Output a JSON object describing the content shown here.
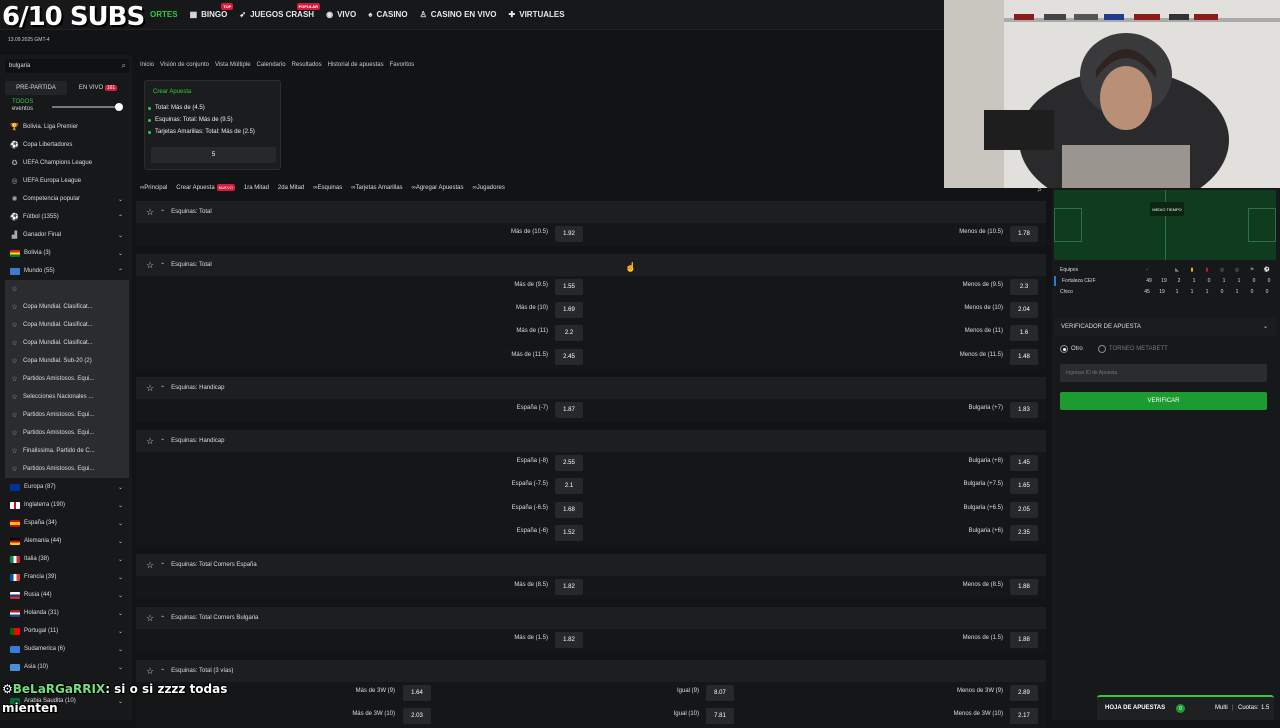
{
  "overlay": {
    "subs": "6/10 SUBS",
    "date": "13.09.2025 GMT-4"
  },
  "topnav": {
    "sports": "ORTES",
    "bingo": "BINGO",
    "bingo_badge": "TOP",
    "crash": "JUEGOS CRASH",
    "crash_badge": "POPULAR",
    "vivo": "VIVO",
    "casino": "CASINO",
    "casino_vivo": "CASINO EN VIVO",
    "virtuales": "VIRTUALES"
  },
  "sidebar": {
    "search_value": "bulgaria",
    "tab_pre": "PRE-PARTIDA",
    "tab_live": "EN VIVO",
    "live_count": "161",
    "todos": "TODOS",
    "eventos": "eventos",
    "items": [
      {
        "label": "Bolivia. Liga Premier"
      },
      {
        "label": "Copa Libertadores"
      },
      {
        "label": "UEFA Champions League"
      },
      {
        "label": "UEFA Europa League"
      },
      {
        "label": "Competencia popular"
      },
      {
        "label": "Fútbol (1355)"
      },
      {
        "label": "Ganador Final"
      },
      {
        "label": "Bolivia (3)"
      },
      {
        "label": "Mundo (55)"
      },
      {
        "label": ""
      },
      {
        "label": "Copa Mundial. Clasificat..."
      },
      {
        "label": "Copa Mundial. Clasificat..."
      },
      {
        "label": "Copa Mundial. Clasificat..."
      },
      {
        "label": "Copa Mundial. Sub-20 (2)"
      },
      {
        "label": "Partidos Amistosos. Equi..."
      },
      {
        "label": "Selecciones Nacionales ..."
      },
      {
        "label": "Partidos Amistosos. Equi..."
      },
      {
        "label": "Partidos Amistosos. Equi..."
      },
      {
        "label": "Finalissima. Partido de C..."
      },
      {
        "label": "Partidos Amistosos. Equi..."
      },
      {
        "label": "Europa (87)"
      },
      {
        "label": "Inglaterra (190)"
      },
      {
        "label": "España (34)"
      },
      {
        "label": "Alemania (44)"
      },
      {
        "label": "Italia (38)"
      },
      {
        "label": "Francia (39)"
      },
      {
        "label": "Rusia (44)"
      },
      {
        "label": "Holanda (31)"
      },
      {
        "label": "Portugal (11)"
      },
      {
        "label": "Sudamerica (6)"
      },
      {
        "label": "Asia (10)"
      },
      {
        "label": "Arabia Saudita (10)"
      }
    ]
  },
  "breadcrumb": [
    "Inicio",
    "Visión de conjunto",
    "Vista Múltiple",
    "Calendario",
    "Resultados",
    "Historial de apuestas",
    "Favoritos"
  ],
  "betbuilder": {
    "title": "Crear Apuesta",
    "lines": [
      "Total: Más de (4.5)",
      "Esquinas: Total: Más de (9.5)",
      "Tarjetas Amarillas: Total: Más de (2.5)"
    ],
    "count": "5"
  },
  "market_tabs": {
    "principal": "Principal",
    "crear": "Crear Apuesta",
    "nuevo": "NUEVO",
    "mitad1": "1ra Mitad",
    "mitad2": "2da Mitad",
    "esquinas": "Esquinas",
    "tarjetas": "Tarjetas Amarillas",
    "agregar": "Agregar Apuestas",
    "jugadores": "Jugadores"
  },
  "markets": {
    "m1": {
      "title": "Esquinas: Total",
      "rows": [
        {
          "l": "Más de (10.5)",
          "lo": "1.92",
          "r": "Menos de (10.5)",
          "ro": "1.78"
        }
      ]
    },
    "m2": {
      "title": "Esquinas: Total",
      "rows": [
        {
          "l": "Más de (9.5)",
          "lo": "1.55",
          "r": "Menos de (9.5)",
          "ro": "2.3"
        },
        {
          "l": "Más de (10)",
          "lo": "1.69",
          "r": "Menos de (10)",
          "ro": "2.04"
        },
        {
          "l": "Más de (11)",
          "lo": "2.2",
          "r": "Menos de (11)",
          "ro": "1.6"
        },
        {
          "l": "Más de (11.5)",
          "lo": "2.45",
          "r": "Menos de (11.5)",
          "ro": "1.48"
        }
      ]
    },
    "m3": {
      "title": "Esquinas: Handicap",
      "rows": [
        {
          "l": "España (-7)",
          "lo": "1.87",
          "r": "Bulgaria (+7)",
          "ro": "1.83"
        }
      ]
    },
    "m4": {
      "title": "Esquinas: Handicap",
      "rows": [
        {
          "l": "España (-8)",
          "lo": "2.55",
          "r": "Bulgaria (+8)",
          "ro": "1.45"
        },
        {
          "l": "España (-7.5)",
          "lo": "2.1",
          "r": "Bulgaria (+7.5)",
          "ro": "1.65"
        },
        {
          "l": "España (-6.5)",
          "lo": "1.68",
          "r": "Bulgaria (+6.5)",
          "ro": "2.05"
        },
        {
          "l": "España (-6)",
          "lo": "1.52",
          "r": "Bulgaria (+6)",
          "ro": "2.35"
        }
      ]
    },
    "m5": {
      "title": "Esquinas: Total Corners España",
      "rows": [
        {
          "l": "Más de (8.5)",
          "lo": "1.82",
          "r": "Menos de (8.5)",
          "ro": "1.88"
        }
      ]
    },
    "m6": {
      "title": "Esquinas: Total Corners Bulgaria",
      "rows": [
        {
          "l": "Más de (1.5)",
          "lo": "1.82",
          "r": "Menos de (1.5)",
          "ro": "1.88"
        }
      ]
    },
    "m7": {
      "title": "Esquinas: Total (3 vías)",
      "rows": [
        {
          "l": "Más de 3W (9)",
          "lo": "1.64",
          "m": "Igual (9)",
          "mo": "8.07",
          "r": "Menos de 3W (9)",
          "ro": "2.89"
        },
        {
          "l": "Más de 3W (10)",
          "lo": "2.03",
          "m": "Igual (10)",
          "mo": "7.81",
          "r": "Menos de 3W (10)",
          "ro": "2.17"
        }
      ]
    }
  },
  "live": {
    "pitch_label": "MEDIO TIEMPO",
    "equipos": "Equipos",
    "teams": [
      {
        "name": "Fortaleza CEIF",
        "vals": [
          "49",
          "19",
          "2",
          "1",
          "0",
          "1",
          "1",
          "0",
          "0"
        ]
      },
      {
        "name": "Chico",
        "vals": [
          "45",
          "19",
          "1",
          "1",
          "1",
          "0",
          "1",
          "0",
          "0"
        ]
      }
    ]
  },
  "verifier": {
    "title": "VERIFICADOR DE APUESTA",
    "opt1": "Otro",
    "opt2": "TORNEO METABETT",
    "placeholder": "Ingresar ID de Apuesta",
    "button": "VERIFICAR"
  },
  "hoja": {
    "label": "HOJA DE APUESTAS",
    "count": "0",
    "multi": "Multi",
    "cuotas_label": "Cuotas:",
    "cuotas": "1.5"
  },
  "chat": {
    "user": "BeLaRGaRRIX",
    "msg": ": si o si zzzz todas",
    "msg2": "mienten"
  }
}
